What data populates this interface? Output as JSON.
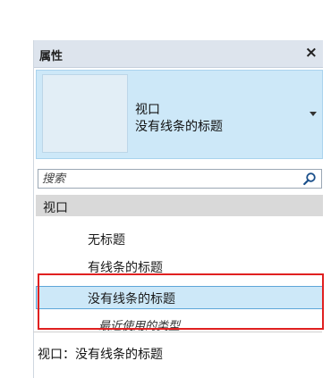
{
  "panel": {
    "title": "属性",
    "close_glyph": "×",
    "type_selector": {
      "family": "视口",
      "type": "没有线条的标题"
    },
    "search": {
      "placeholder": "搜索"
    },
    "group_header": "视口",
    "items": [
      {
        "label": "无标题"
      },
      {
        "label": "有线条的标题"
      },
      {
        "label": "没有线条的标题",
        "selected": true
      }
    ],
    "recent_label": "最近使用的类型",
    "status": "视口：没有线条的标题"
  },
  "colors": {
    "titlebar_bg": "#dde4ed",
    "selection_bg": "#cde8f8",
    "selection_border": "#5ea6d8",
    "group_header_bg": "#d9d9d9",
    "highlight_red": "#e02020"
  }
}
